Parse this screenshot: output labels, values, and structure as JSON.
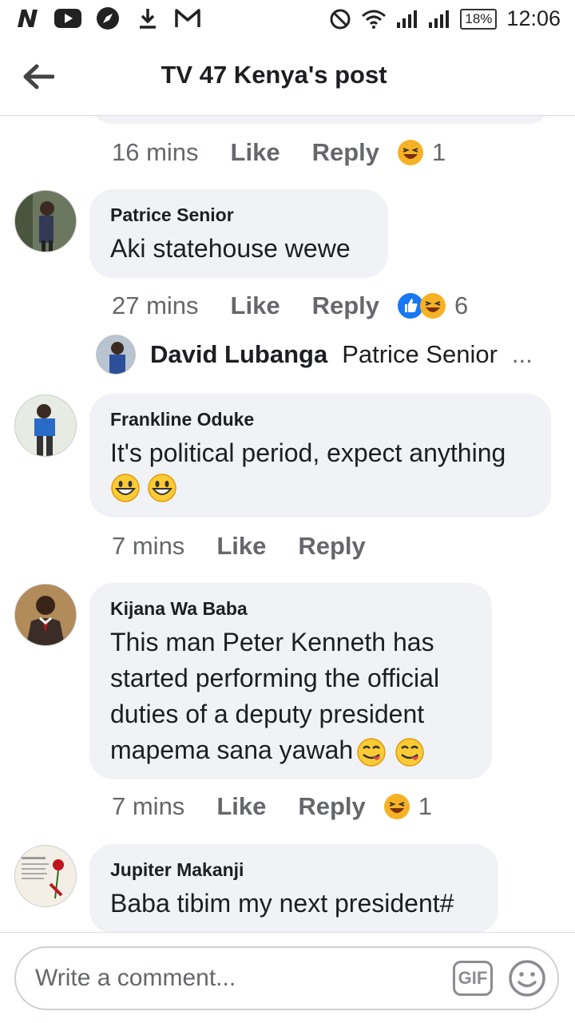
{
  "status_bar": {
    "icons": [
      "n-icon",
      "youtube-icon",
      "compass-icon",
      "download-icon",
      "gmail-icon",
      "dnd-icon",
      "wifi-icon",
      "signal-icon",
      "signal-icon"
    ],
    "battery": "18%",
    "time": "12:06"
  },
  "header": {
    "title": "TV 47 Kenya's post"
  },
  "labels": {
    "like": "Like",
    "reply": "Reply"
  },
  "prev_comment_meta": {
    "time": "16 mins",
    "reaction_count": "1",
    "reactions": [
      "haha-icon"
    ]
  },
  "comments": [
    {
      "author": "Patrice Senior",
      "text": "Aki statehouse wewe",
      "time": "27 mins",
      "reaction_count": "6",
      "reactions": [
        "like-icon",
        "haha-icon"
      ]
    },
    {
      "author": "Frankline Oduke",
      "text": "It's political period, expect anything",
      "time": "7 mins",
      "reaction_count": "",
      "emojis": [
        "grinning-emoji",
        "grinning-emoji"
      ]
    },
    {
      "author": "Kijana Wa Baba",
      "text": "This man Peter Kenneth has started performing the official duties of a deputy president mapema sana yawah",
      "time": "7 mins",
      "reaction_count": "1",
      "reactions": [
        "haha-icon"
      ],
      "emojis": [
        "yum-emoji",
        "yum-emoji"
      ]
    },
    {
      "author": "Jupiter Makanji",
      "text": "Baba tibim my next president#"
    }
  ],
  "reply_preview": {
    "name": "David Lubanga",
    "text": "Patrice Senior",
    "ellipsis": "..."
  },
  "composer": {
    "placeholder": "Write a comment...",
    "gif_label": "GIF"
  },
  "colors": {
    "bubble": "#f0f2f5",
    "meta": "#65676b",
    "like_blue": "#1877f2",
    "haha_yellow": "#f7b125"
  }
}
